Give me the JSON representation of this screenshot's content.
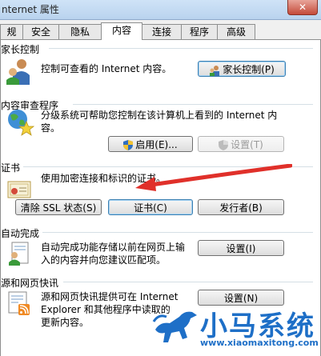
{
  "window": {
    "title": "nternet 属性",
    "close_label": "✕"
  },
  "tabs": [
    {
      "label": "规"
    },
    {
      "label": "安全"
    },
    {
      "label": "隐私"
    },
    {
      "label": "内容"
    },
    {
      "label": "连接"
    },
    {
      "label": "程序"
    },
    {
      "label": "高级"
    }
  ],
  "active_tab": "内容",
  "parental": {
    "title": "家长控制",
    "desc": "控制可查看的 Internet 内容。",
    "button": "家长控制(P)"
  },
  "advisor": {
    "title": "内容审查程序",
    "desc_line1": "分级系统可帮助您控制在该计算机上看到的 Internet 内",
    "desc_line2": "容。",
    "enable_button": "启用(E)...",
    "settings_button": "设置(T)"
  },
  "certs": {
    "title": "证书",
    "desc": "使用加密连接和标识的证书。",
    "clear_ssl_button": "清除 SSL 状态(S)",
    "certs_button": "证书(C)",
    "publishers_button": "发行者(B)"
  },
  "autocomplete": {
    "title": "自动完成",
    "desc_line1": "自动完成功能存储以前在网页上输",
    "desc_line2": "入的内容并向您建议匹配项。",
    "settings_button": "设置(I)"
  },
  "feeds": {
    "title": "源和网页快讯",
    "desc_line1": "源和网页快讯提供可在 Internet",
    "desc_line2": "Explorer 和其他程序中读取的",
    "desc_line3": "更新内容。",
    "settings_button": "设置(N)"
  },
  "watermark": {
    "text": "小马系统",
    "url": "www.xiaomaxitong.com"
  },
  "colors": {
    "accent": "#1e6fc7",
    "arrow": "#e0302a"
  }
}
